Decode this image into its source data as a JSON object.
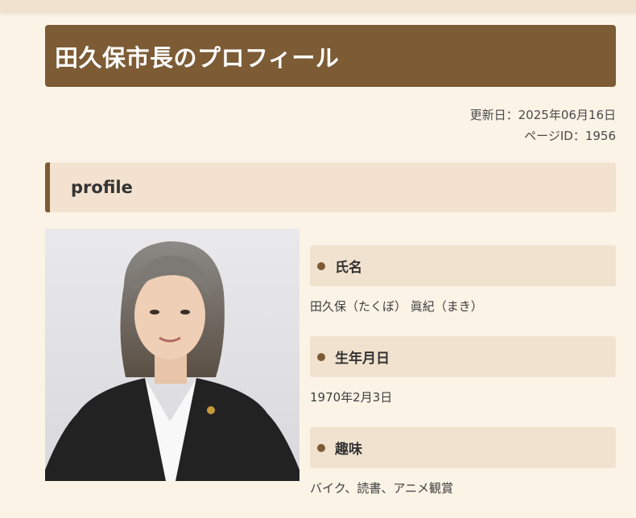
{
  "page": {
    "title": "田久保市長のプロフィール",
    "updated": "更新日：2025年06月16日",
    "page_id": "ページID：1956"
  },
  "section": {
    "heading": "profile"
  },
  "profile": {
    "photo_alt": "田久保市長の写真",
    "items": [
      {
        "label": "氏名",
        "value": "田久保（たくぼ） 眞紀（まき）"
      },
      {
        "label": "生年月日",
        "value": "1970年2月3日"
      },
      {
        "label": "趣味",
        "value": "バイク、読書、アニメ観賞"
      }
    ]
  },
  "colors": {
    "accent": "#7c5b35",
    "label_bg": "#f1e2cf",
    "page_bg": "#fbf3e6"
  }
}
